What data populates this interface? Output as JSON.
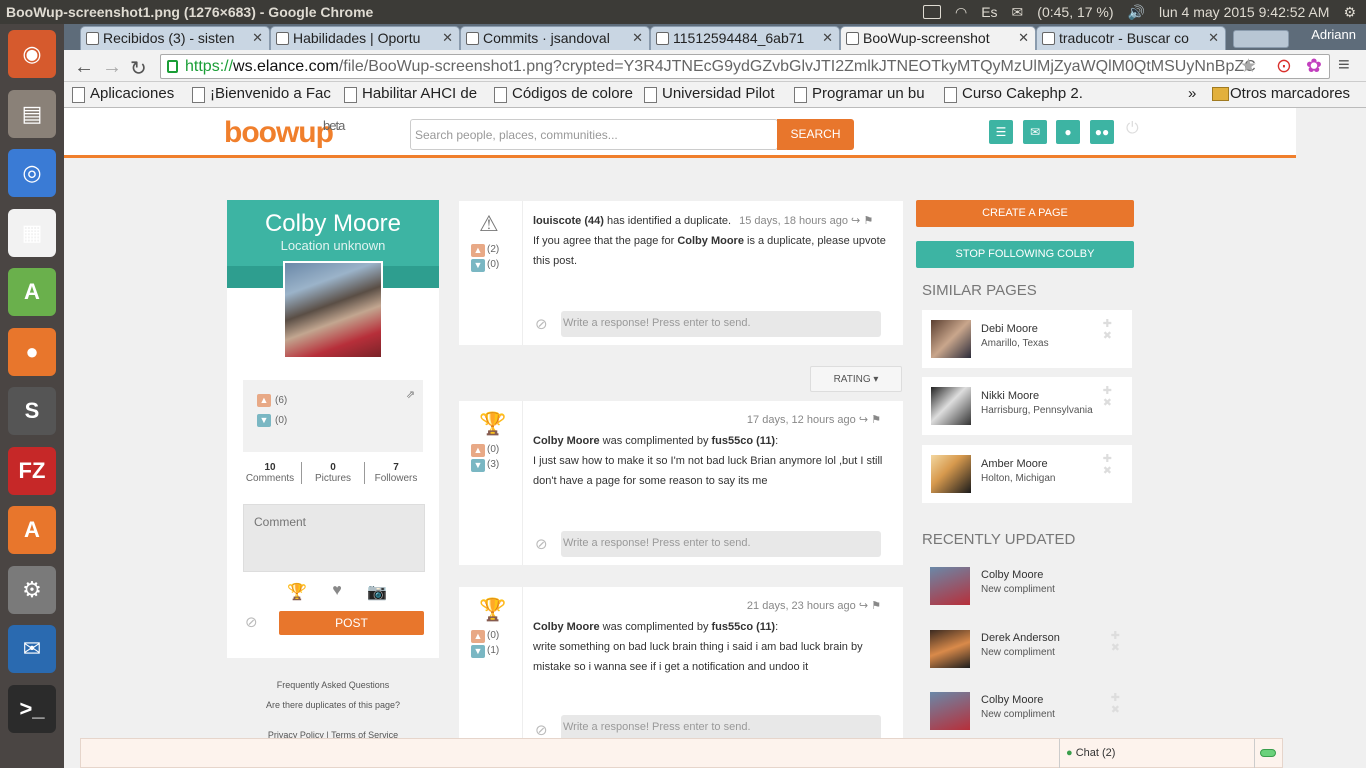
{
  "os": {
    "window_title": "BooWup-screenshot1.png (1276×683) - Google Chrome",
    "indicators": [
      "Es",
      "(0:45, 17 %)"
    ],
    "clock": "lun 4 may 2015  9:42:52 AM"
  },
  "launcher": [
    {
      "name": "ubuntu-dash-icon",
      "glyph": "◉",
      "color": "#d65a2d"
    },
    {
      "name": "files-icon",
      "glyph": "▤",
      "color": "#8a8178"
    },
    {
      "name": "chrome-icon",
      "glyph": "◎",
      "color": "#3a7bd5"
    },
    {
      "name": "apps-icon",
      "glyph": "▦",
      "color": "#f2f2f2"
    },
    {
      "name": "android-studio-icon",
      "glyph": "A",
      "color": "#6ab04c"
    },
    {
      "name": "firefox-icon",
      "glyph": "●",
      "color": "#e8762c"
    },
    {
      "name": "sublime-icon",
      "glyph": "S",
      "color": "#555"
    },
    {
      "name": "filezilla-icon",
      "glyph": "FZ",
      "color": "#c62828"
    },
    {
      "name": "software-center-icon",
      "glyph": "A",
      "color": "#e8762c"
    },
    {
      "name": "settings-icon",
      "glyph": "⚙",
      "color": "#7a7a7a"
    },
    {
      "name": "thunderbird-icon",
      "glyph": "✉",
      "color": "#2a6ab0"
    },
    {
      "name": "terminal-icon",
      "glyph": ">_",
      "color": "#2b2b2b"
    }
  ],
  "browser": {
    "tabs": [
      "Recibidos (3) - sisten",
      "Habilidades | Oportu",
      "Commits · jsandoval",
      "11512594484_6ab71",
      "BooWup-screenshot",
      "traducotr - Buscar co"
    ],
    "profile_name": "Adriann",
    "url_https": "https://",
    "url_domain": "ws.elance.com",
    "url_rest": "/file/BooWup-screenshot1.png?crypted=Y3R4JTNEcG9ydGZvbGlvJTI2ZmlkJTNEOTkyMTQyMzUlMjZyaWQlM0QtMSUyNnBpZC",
    "bookmarks": [
      "Aplicaciones",
      "¡Bienvenido a Fac",
      "Habilitar AHCI de",
      "Códigos de colore",
      "Universidad Pilot",
      "Programar un bu",
      "Curso Cakephp 2.",
      "»",
      "Otros marcadores"
    ]
  },
  "site": {
    "logo": "boowup",
    "logo_sup": "beta",
    "search_placeholder": "Search people, places, communities...",
    "search_btn": "SEARCH",
    "header_icons": [
      "list-icon",
      "mail-icon",
      "user-icon",
      "group-icon"
    ],
    "power_icon": "⏻"
  },
  "profile": {
    "name": "Colby Moore",
    "location": "Location unknown",
    "upvotes": "(6)",
    "downvotes": "(0)",
    "stats": [
      {
        "value": "10",
        "label": "Comments"
      },
      {
        "value": "0",
        "label": "Pictures"
      },
      {
        "value": "7",
        "label": "Followers"
      }
    ],
    "comment_placeholder": "Comment",
    "post_btn": "POST",
    "links": [
      "Frequently Asked Questions",
      "Are there duplicates of this page?",
      "Privacy Policy | Terms of Service"
    ]
  },
  "feed": {
    "respond_placeholder": "Write a response! Press enter to send.",
    "rating_btn": "RATING ▾",
    "posts": [
      {
        "up": "(2)",
        "down": "(0)",
        "author": "louiscote (44)",
        "action": " has identified a duplicate.",
        "time": "15 days, 18 hours ago",
        "body_pre": "If you agree that the page for ",
        "body_bold": "Colby Moore",
        "body_post": " is a duplicate, please upvote this post."
      },
      {
        "up": "(0)",
        "down": "(3)",
        "time": "17 days, 12 hours ago",
        "subject": "Colby Moore",
        "action": " was complimented by ",
        "by": "fus55co (11)",
        "colon": ":",
        "body": "I just saw how to make it so I'm not bad luck Brian anymore lol ,but I still don't have a page for some reason to say its me"
      },
      {
        "up": "(0)",
        "down": "(1)",
        "time": "21 days, 23 hours ago",
        "subject": "Colby Moore",
        "action": " was complimented by ",
        "by": "fus55co (11)",
        "colon": ":",
        "body": "write something on bad luck brain thing i said i am bad luck brain by mistake so i wanna see if i get a notification and undoo it"
      }
    ]
  },
  "sidebar": {
    "create_page": "CREATE A PAGE",
    "stop_following": "STOP FOLLOWING COLBY",
    "similar_title": "SIMILAR PAGES",
    "similar": [
      {
        "name": "Debi Moore",
        "place": "Amarillo, Texas"
      },
      {
        "name": "Nikki Moore",
        "place": "Harrisburg, Pennsylvania"
      },
      {
        "name": "Amber Moore",
        "place": "Holton, Michigan"
      }
    ],
    "recent_title": "RECENTLY UPDATED",
    "recent": [
      {
        "name": "Colby Moore",
        "status": "New compliment"
      },
      {
        "name": "Derek Anderson",
        "status": "New compliment"
      },
      {
        "name": "Colby Moore",
        "status": "New compliment"
      }
    ]
  },
  "chat": {
    "label": "Chat (2)"
  },
  "colors": {
    "brand_orange": "#e8762c",
    "teal": "#3db4a3"
  }
}
